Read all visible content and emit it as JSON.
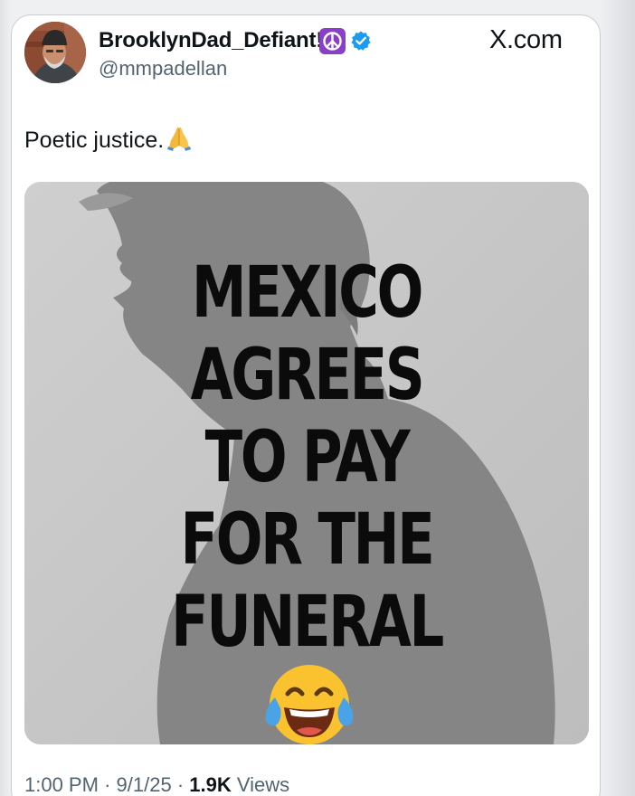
{
  "tweet": {
    "display_name": "BrooklynDad_Defiant!",
    "handle": "@mmpadellan",
    "site": "X.com",
    "text": "Poetic justice.",
    "emoji_after_text": "folded-hands",
    "badges": [
      "peace-symbol-icon",
      "verified-badge-icon"
    ],
    "verified_color": "#1d9bf0",
    "badge_purple": "#8b3fc9",
    "time": "1:00 PM",
    "date": "9/1/25",
    "views_count": "1.9K",
    "views_label": "Views",
    "separator": "·"
  },
  "media": {
    "lines": [
      "MEXICO",
      "AGREES",
      "TO PAY",
      "FOR THE",
      "FUNERAL"
    ],
    "emoji": "face-with-tears-of-joy",
    "background_color": "#c4c4c4",
    "silhouette_color": "#858585"
  }
}
